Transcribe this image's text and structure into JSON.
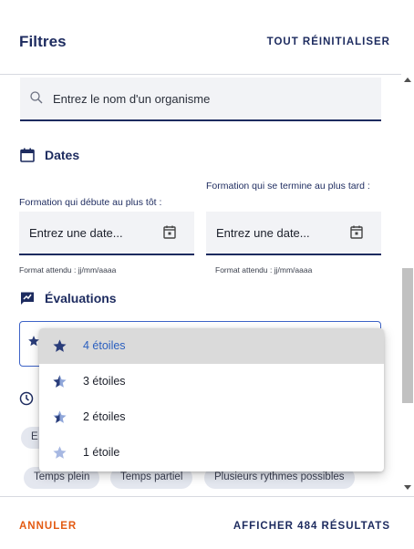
{
  "header": {
    "title": "Filtres",
    "reset_label": "TOUT RÉINITIALISER"
  },
  "search": {
    "placeholder": "Entrez le nom d'un organisme"
  },
  "dates": {
    "title": "Dates",
    "start_label": "Formation qui débute au plus tôt :",
    "end_label": "Formation qui se termine au plus tard :",
    "start_value": "Entrez une date...",
    "end_value": "Entrez une date...",
    "start_hint": "Format attendu : jj/mm/aaaa",
    "end_hint": "Format attendu : jj/mm/aaaa"
  },
  "evaluations": {
    "title": "Évaluations",
    "options": [
      {
        "label": "4 étoiles",
        "selected": true
      },
      {
        "label": "3 étoiles",
        "selected": false
      },
      {
        "label": "2 étoiles",
        "selected": false
      },
      {
        "label": "1 étoile",
        "selected": false
      }
    ]
  },
  "rhythm": {
    "chips": [
      "Temps plein",
      "Temps partiel",
      "Plusieurs rythmes possibles"
    ],
    "chip_partial": "E"
  },
  "footer": {
    "cancel_label": "ANNULER",
    "apply_label": "AFFICHER 484 RÉSULTATS"
  },
  "colors": {
    "primary": "#1d2b5f",
    "accent": "#e35a12",
    "selected": "#2a5fbf",
    "star_a": "#2a3d7a",
    "star_b": "#8fa6d9"
  },
  "icons": [
    "search-icon",
    "calendar-icon",
    "chat-rating-icon",
    "star-icon",
    "clock-icon"
  ]
}
